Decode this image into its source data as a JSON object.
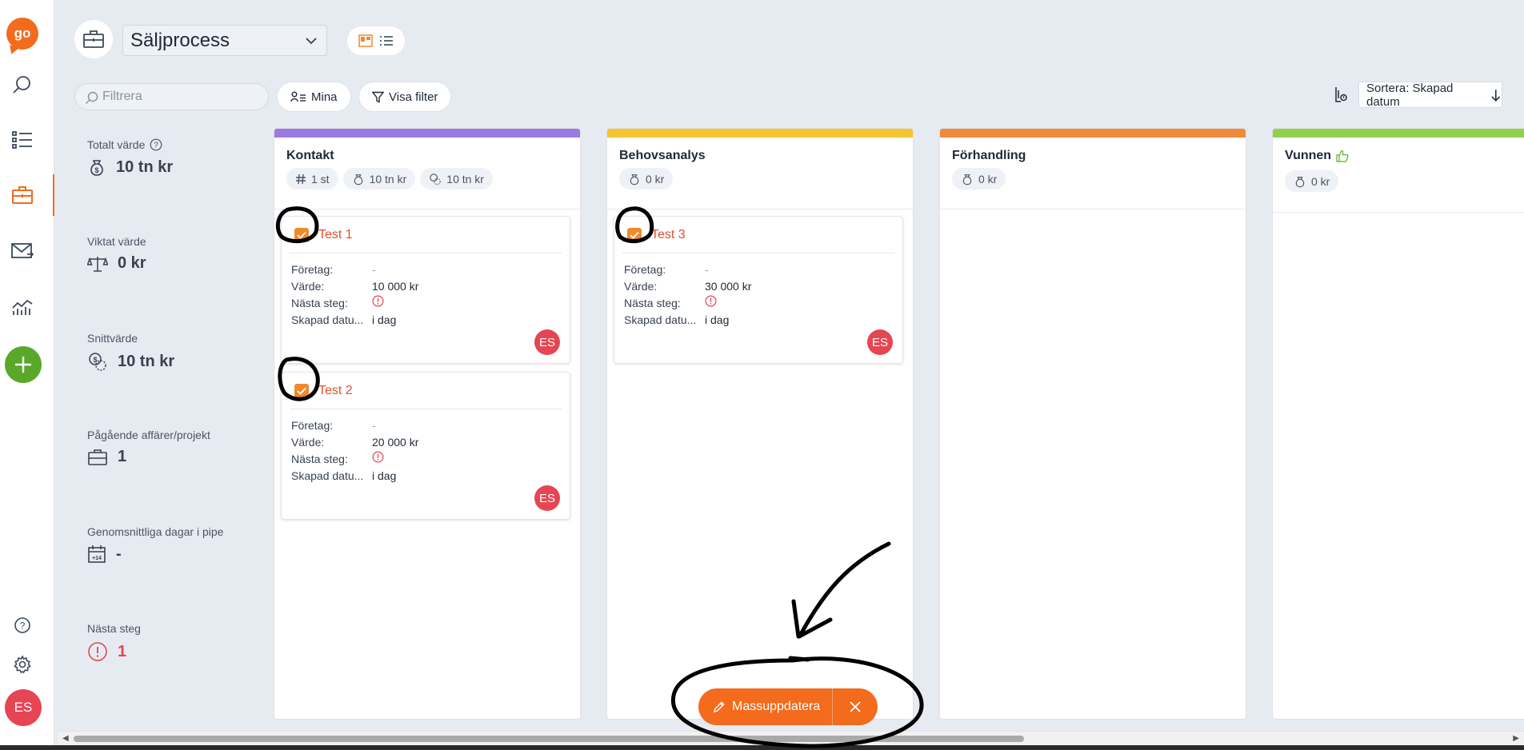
{
  "app": {
    "logo_text": "go",
    "user_initials": "ES",
    "accent_color": "#f36b1c"
  },
  "sidebar": {
    "items": [
      {
        "name": "search-icon"
      },
      {
        "name": "list-icon"
      },
      {
        "name": "briefcase-icon",
        "active": true
      },
      {
        "name": "mail-icon"
      },
      {
        "name": "chart-icon"
      }
    ]
  },
  "header": {
    "pipeline": "Säljprocess",
    "filter_placeholder": "Filtrera",
    "mine_label": "Mina",
    "show_filter_label": "Visa filter",
    "sort_label": "Sortera: Skapad datum"
  },
  "stats": [
    {
      "label": "Totalt värde",
      "value": "10 tn kr",
      "icon": "money-bag-icon",
      "help": true
    },
    {
      "label": "Viktat värde",
      "value": "0 kr",
      "icon": "scale-icon"
    },
    {
      "label": "Snittvärde",
      "value": "10 tn kr",
      "icon": "average-coins-icon"
    },
    {
      "label": "Pågående affärer/projekt",
      "value": "1",
      "icon": "briefcase-icon"
    },
    {
      "label": "Genomsnittliga dagar i pipe",
      "value": "-",
      "icon": "calendar-icon"
    },
    {
      "label": "Nästa steg",
      "value": "1",
      "icon": "alert-icon",
      "color": "#e64553"
    }
  ],
  "columns": [
    {
      "title": "Kontakt",
      "color": "#9b7be0",
      "chips": [
        "1 st",
        "10 tn kr",
        "10 tn kr"
      ],
      "cards": [
        {
          "title": "Test 1",
          "rows": {
            "company_label": "Företag:",
            "company": "-",
            "value_label": "Värde:",
            "value": "10 000 kr",
            "next_label": "Nästa steg:",
            "created_label": "Skapad datu...",
            "created": "i dag"
          },
          "avatar": "ES"
        },
        {
          "title": "Test 2",
          "rows": {
            "company_label": "Företag:",
            "company": "-",
            "value_label": "Värde:",
            "value": "20 000 kr",
            "next_label": "Nästa steg:",
            "created_label": "Skapad datu...",
            "created": "i dag"
          },
          "avatar": "ES"
        }
      ]
    },
    {
      "title": "Behovsanalys",
      "color": "#f5c431",
      "chips": [
        "0 kr"
      ],
      "cards": [
        {
          "title": "Test 3",
          "rows": {
            "company_label": "Företag:",
            "company": "-",
            "value_label": "Värde:",
            "value": "30 000 kr",
            "next_label": "Nästa steg:",
            "created_label": "Skapad datu...",
            "created": "i dag"
          },
          "avatar": "ES"
        }
      ]
    },
    {
      "title": "Förhandling",
      "color": "#f08a3c",
      "chips": [
        "0 kr"
      ],
      "cards": []
    },
    {
      "title": "Vunnen",
      "color": "#8fd14f",
      "chips": [
        "0 kr"
      ],
      "cards": []
    }
  ],
  "bulk": {
    "label": "Massuppdatera"
  }
}
